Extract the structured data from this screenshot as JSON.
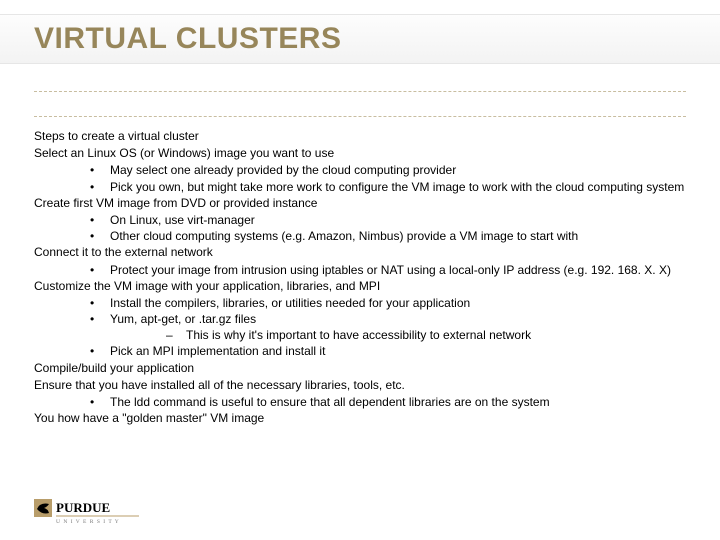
{
  "title": "VIRTUAL CLUSTERS",
  "c": {
    "intro": "Steps to create a virtual cluster",
    "step1": "Select an Linux OS (or Windows) image you want to use",
    "s1b1": "May select one already provided by the cloud computing provider",
    "s1b2": "Pick you own, but might take more work to configure the VM image to work with the cloud computing system",
    "step2": "Create first VM image from DVD or provided instance",
    "s2b1": "On Linux, use virt-manager",
    "s2b2": "Other cloud computing systems (e.g. Amazon, Nimbus) provide a VM image to start with",
    "step3": "Connect it to the external network",
    "s3b1": "Protect your image from intrusion using iptables or NAT using a local-only IP address (e.g. 192. 168. X. X)",
    "step4": "Customize the VM image with your application, libraries, and MPI",
    "s4b1": "Install the compilers, libraries, or utilities needed for your application",
    "s4b2": "Yum, apt-get, or .tar.gz files",
    "s4b2a": "This is why it's important to have accessibility to external network",
    "s4b3": "Pick an MPI implementation and install it",
    "step5": "Compile/build your application",
    "step6": "Ensure that you have installed all of the necessary libraries, tools, etc.",
    "s6b1": "The ldd command is useful to ensure that all dependent libraries are on the system",
    "step7": "You how have a \"golden master\" VM image"
  },
  "logo": {
    "main": "PURDUE",
    "sub": "U N I V E R S I T Y"
  }
}
